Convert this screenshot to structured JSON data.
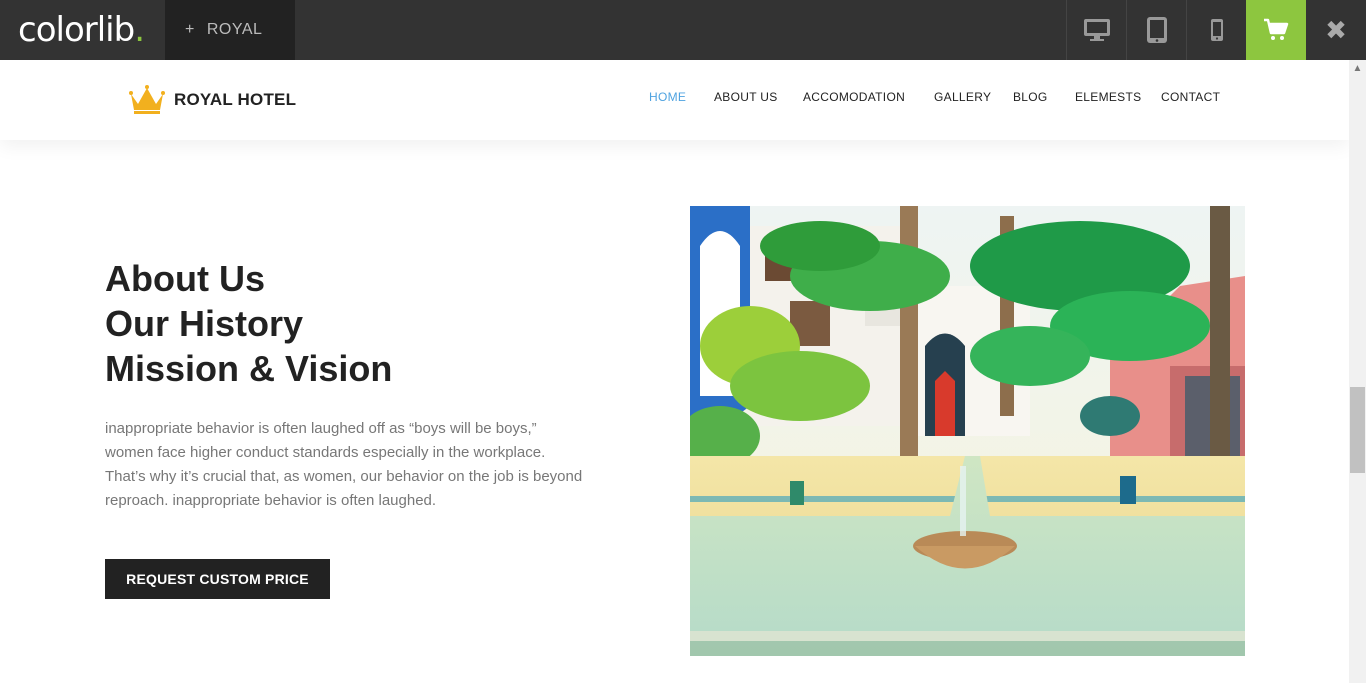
{
  "topbar": {
    "brand_text": "colorlib",
    "brand_dot": ".",
    "tab_plus": "+",
    "tab_label": "ROYAL",
    "close_symbol": "✖",
    "accent": "#8dc63f"
  },
  "site": {
    "logo_text": "ROYAL HOTEL",
    "nav": {
      "home": "HOME",
      "about": "ABOUT US",
      "accomodation": "ACCOMODATION",
      "gallery": "GALLERY",
      "blog": "BLOG",
      "elements": "ELEMESTS",
      "contact": "CONTACT"
    },
    "nav_active_color": "#4fa3e0"
  },
  "about": {
    "heading_1": "About Us",
    "heading_2": "Our History",
    "heading_3": "Mission & Vision",
    "paragraph": "inappropriate behavior is often laughed off as “boys will be boys,” women face higher conduct standards especially in the workplace. That’s why it’s crucial that, as women, our behavior on the job is beyond reproach. inappropriate behavior is often laughed.",
    "button": "REQUEST CUSTOM PRICE"
  }
}
